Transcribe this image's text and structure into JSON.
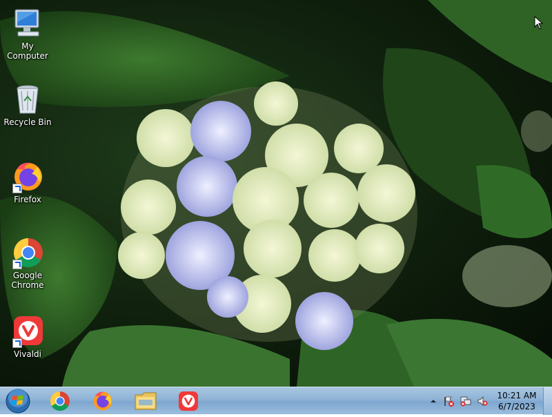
{
  "desktop": {
    "icons": [
      {
        "label": "My Computer",
        "icon": "my-computer-icon"
      },
      {
        "label": "Recycle Bin",
        "icon": "recycle-bin-icon"
      },
      {
        "label": "Firefox",
        "icon": "firefox-icon",
        "shortcut": true
      },
      {
        "label": "Google Chrome",
        "icon": "chrome-icon",
        "shortcut": true
      },
      {
        "label": "Vivaldi",
        "icon": "vivaldi-icon",
        "shortcut": true
      }
    ]
  },
  "taskbar": {
    "start": {
      "icon": "windows-start-orb-icon"
    },
    "pinned": [
      {
        "icon": "chrome-icon"
      },
      {
        "icon": "firefox-icon"
      },
      {
        "icon": "file-explorer-icon"
      },
      {
        "icon": "vivaldi-icon"
      }
    ],
    "tray": {
      "icons": [
        "show-hidden-icons-chevron",
        "action-center-flag-icon",
        "network-disconnected-icon",
        "volume-muted-icon"
      ],
      "time": "10:21 AM",
      "date": "6/7/2023"
    }
  },
  "colors": {
    "vivaldi": "#ef3939",
    "taskbar": "#8fb3d6"
  }
}
